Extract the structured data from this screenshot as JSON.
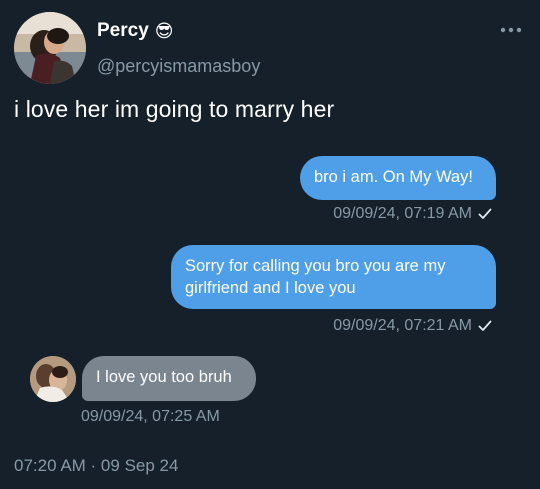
{
  "author": {
    "display_name": "Percy",
    "emoji": "😎",
    "handle": "@percyismamasboy",
    "avatar_icon": "profile-photo-couple"
  },
  "tweet": {
    "text": "i love her im going to marry her",
    "timestamp": "07:20 AM · 09 Sep 24"
  },
  "messages": [
    {
      "direction": "outgoing",
      "text": "bro i am. On My Way!",
      "time": "09/09/24, 07:19 AM",
      "status_icon": "check-icon"
    },
    {
      "direction": "outgoing",
      "text": "Sorry for calling you bro you are my girlfriend and I love you",
      "time": "09/09/24, 07:21 AM",
      "status_icon": "check-icon"
    },
    {
      "direction": "incoming",
      "text": "I love you too bruh",
      "time": "09/09/24, 07:25 AM",
      "avatar_icon": "contact-photo"
    }
  ],
  "colors": {
    "background": "#15202b",
    "outgoing_bubble": "#4e9ee8",
    "incoming_bubble": "#7b8590",
    "muted_text": "#8899a6"
  }
}
